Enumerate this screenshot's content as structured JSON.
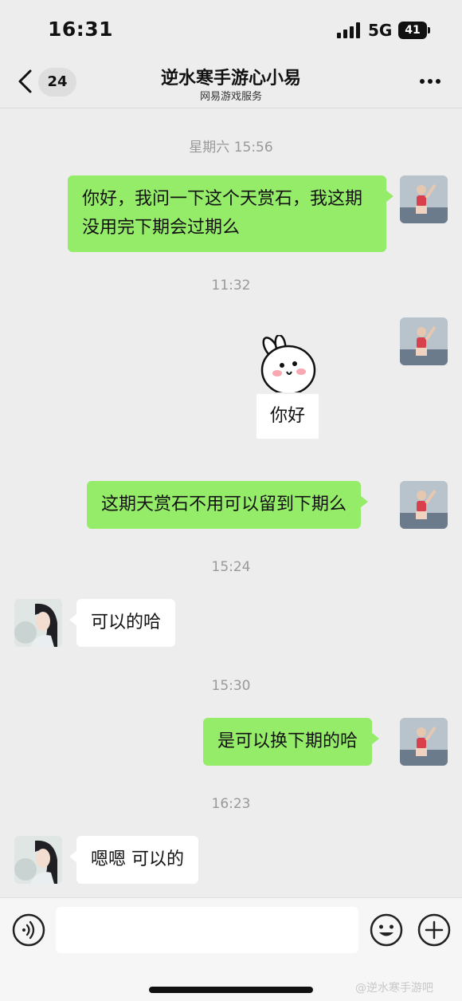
{
  "status_bar": {
    "time": "16:31",
    "network": "5G",
    "battery": "41"
  },
  "nav": {
    "unread_count": "24",
    "title": "逆水寒手游心小易",
    "subtitle": "网易游戏服务"
  },
  "messages": {
    "ts1": "星期六 15:56",
    "m1": "你好，我问一下这个天赏石，我这期没用完下期会过期么",
    "ts2": "11:32",
    "sticker_text": "你好",
    "m2": "这期天赏石不用可以留到下期么",
    "ts3": "15:24",
    "m3": "可以的哈",
    "ts4": "15:30",
    "m4": "是可以换下期的哈",
    "ts5": "16:23",
    "m5": "嗯嗯 可以的"
  },
  "watermark": "@逆水寒手游吧",
  "icons": {
    "back": "chevron-left-icon",
    "more": "more-dots-icon",
    "voice": "voice-icon",
    "emoji": "emoji-icon",
    "plus": "plus-icon"
  },
  "colors": {
    "outgoing_bubble": "#95ec69",
    "incoming_bubble": "#ffffff",
    "background": "#ededed"
  }
}
